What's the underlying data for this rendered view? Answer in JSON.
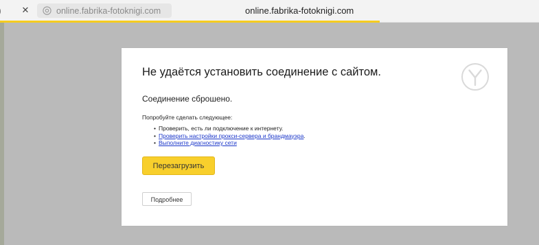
{
  "browser": {
    "left_edge_glyph": ")",
    "close_glyph": "✕",
    "address_url": "online.fabrika-fotoknigi.com",
    "tab_title": "online.fabrika-fotoknigi.com"
  },
  "colors": {
    "accent": "#f6cc1f",
    "button_yellow": "#f8cf2c",
    "link": "#1a36c9",
    "backdrop": "#bababa"
  },
  "error_page": {
    "title": "Не удаётся установить соединение с сайтом.",
    "subtitle": "Соединение сброшено.",
    "try_label": "Попробуйте сделать следующее:",
    "suggestions": [
      "Проверить, есть ли подключение к интернету.",
      "Проверить настройки прокси-сервера и брандмауэра",
      "Выполните диагностику сети"
    ],
    "suggestion_suffix_1": ".",
    "reload_label": "Перезагрузить",
    "details_label": "Подробнее",
    "logo_icon": "yandex-browser-icon"
  }
}
